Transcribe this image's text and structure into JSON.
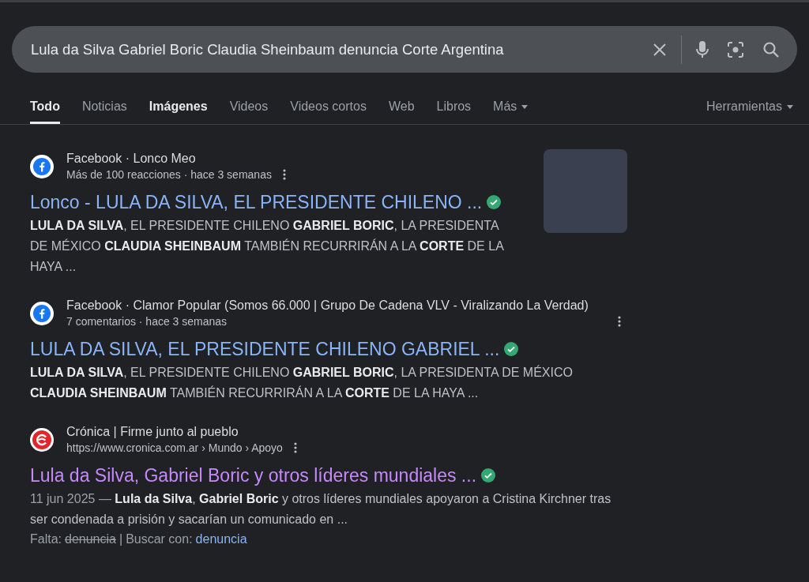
{
  "search": {
    "value": "Lula da Silva Gabriel Boric Claudia Sheinbaum denuncia Corte Argentina"
  },
  "tabs": [
    {
      "label": "Todo",
      "selected": true,
      "emphasized": false,
      "kind": "tab"
    },
    {
      "label": "Noticias",
      "selected": false,
      "emphasized": false,
      "kind": "tab"
    },
    {
      "label": "Imágenes",
      "selected": false,
      "emphasized": true,
      "kind": "tab"
    },
    {
      "label": "Videos",
      "selected": false,
      "emphasized": false,
      "kind": "tab"
    },
    {
      "label": "Videos cortos",
      "selected": false,
      "emphasized": false,
      "kind": "tab"
    },
    {
      "label": "Web",
      "selected": false,
      "emphasized": false,
      "kind": "tab"
    },
    {
      "label": "Libros",
      "selected": false,
      "emphasized": false,
      "kind": "tab"
    },
    {
      "label": "Más",
      "selected": false,
      "emphasized": false,
      "kind": "menu"
    }
  ],
  "tools": {
    "label": "Herramientas"
  },
  "results": [
    {
      "kind": "facebook",
      "site": "Facebook · Lonco Meo",
      "meta": "Más de 100 reacciones · hace 3 semanas",
      "title": "Lonco - LULA DA SILVA, EL PRESIDENTE CHILENO ...",
      "visited": false,
      "verified": true,
      "snippet": "**LULA DA SILVA**, EL PRESIDENTE CHILENO **GABRIEL BORIC**, LA PRESIDENTA DE MÉXICO **CLAUDIA SHEINBAUM** TAMBIÉN RECURRIRÁN A LA **CORTE** DE LA HAYA ...",
      "thumbnail": true
    },
    {
      "kind": "facebook",
      "site": "Facebook · Clamor Popular (Somos 66.000 | Grupo De Cadena VLV - Viralizando La Verdad)",
      "meta": "7 comentarios · hace 3 semanas",
      "title": "LULA DA SILVA, EL PRESIDENTE CHILENO GABRIEL ...",
      "visited": false,
      "verified": true,
      "snippet": "**LULA DA SILVA**, EL PRESIDENTE CHILENO **GABRIEL BORIC**, LA PRESIDENTA DE MÉXICO **CLAUDIA SHEINBAUM** TAMBIÉN RECURRIRÁN A LA **CORTE** DE LA HAYA ...",
      "thumbnail": false
    },
    {
      "kind": "cronica",
      "site": "Crónica | Firme junto al pueblo",
      "meta": "https://www.cronica.com.ar › Mundo › Apoyo",
      "title": "Lula da Silva, Gabriel Boric y otros líderes mundiales ...",
      "visited": true,
      "verified": true,
      "date": "11 jun 2025 —",
      "snippet": "**Lula da Silva**, **Gabriel Boric** y otros líderes mundiales apoyaron a Cristina Kirchner tras ser condenada a prisión y sacarían un comunicado en ...",
      "thumbnail": false,
      "missing": {
        "label": "Falta:",
        "term": "denuncia",
        "separator": "|",
        "search_label": "Buscar con:",
        "search_term": "denuncia"
      }
    }
  ]
}
